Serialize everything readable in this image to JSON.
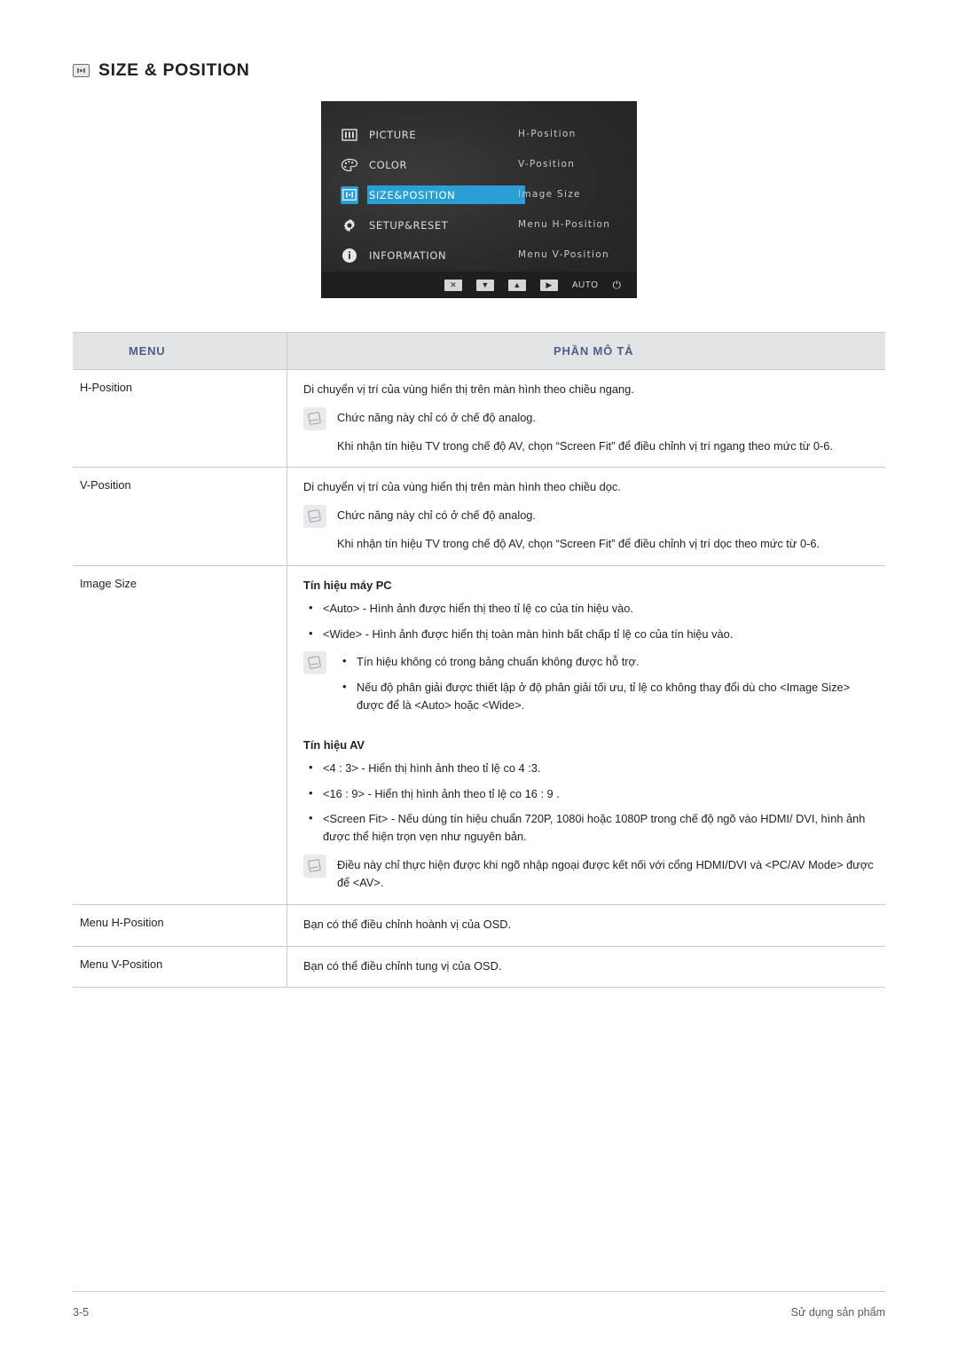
{
  "page": {
    "title": "SIZE & POSITION",
    "title_icon": "size-position-icon",
    "footer_left": "3-5",
    "footer_right": "Sử dụng sản phẩm"
  },
  "osd": {
    "menu_items": [
      {
        "icon": "picture-icon",
        "label": "PICTURE",
        "selected": false
      },
      {
        "icon": "color-icon",
        "label": "COLOR",
        "selected": false
      },
      {
        "icon": "size-position-icon",
        "label": "SIZE&POSITION",
        "selected": true
      },
      {
        "icon": "setup-reset-icon",
        "label": "SETUP&RESET",
        "selected": false
      },
      {
        "icon": "information-icon",
        "label": "INFORMATION",
        "selected": false
      }
    ],
    "submenu_items": [
      "H-Position",
      "V-Position",
      "Image Size",
      "Menu H-Position",
      "Menu V-Position"
    ],
    "buttons": [
      {
        "name": "exit-button",
        "glyph": "✕"
      },
      {
        "name": "down-button",
        "glyph": "▼"
      },
      {
        "name": "up-button",
        "glyph": "▲"
      },
      {
        "name": "enter-button",
        "glyph": "▶"
      },
      {
        "name": "auto-button",
        "glyph": "AUTO"
      },
      {
        "name": "power-button",
        "glyph": "⏻"
      }
    ]
  },
  "table": {
    "headers": {
      "menu": "MENU",
      "description": "PHẦN MÔ TẢ"
    },
    "rows": [
      {
        "menu": "H-Position",
        "desc_main": "Di chuyển vị trí của vùng hiển thị trên màn hình theo chiều ngang.",
        "note1": "Chức năng này chỉ có ở chế độ analog.",
        "note2": "Khi nhận tín hiệu TV trong chế độ AV, chọn “Screen Fit” để điều chỉnh vị trí ngang theo mức từ 0-6."
      },
      {
        "menu": "V-Position",
        "desc_main": "Di chuyển vị trí của vùng hiển thị trên màn hình theo chiều dọc.",
        "note1": "Chức năng này chỉ có ở chế độ analog.",
        "note2": "Khi nhận tín hiệu TV trong chế độ AV, chọn “Screen Fit” để điều chỉnh vị trí dọc theo mức từ 0-6."
      },
      {
        "menu": "Image Size",
        "pc_heading": "Tín hiệu máy PC",
        "pc_bullets": [
          "<Auto> - Hình ảnh được hiển thị theo tỉ lệ co của tín hiệu vào.",
          "<Wide> - Hình ảnh được hiển thị toàn màn hình bất chấp tỉ lệ co của tín hiệu vào."
        ],
        "pc_note_bullets": [
          "Tín hiệu không có trong bảng chuẩn không được hỗ trợ.",
          "Nếu độ phân giải được thiết lập ở độ phân giải tối ưu, tỉ lệ co không thay đổi dù cho <Image Size> được để là <Auto> hoặc <Wide>."
        ],
        "av_heading": "Tín hiệu AV",
        "av_bullets": [
          "<4 : 3> - Hiển thị hình ảnh theo tỉ lệ co 4 :3.",
          "<16 : 9> - Hiển thị hình ảnh theo tỉ lệ co 16 : 9 .",
          "<Screen Fit> - Nếu dùng tín hiệu chuẩn 720P, 1080i hoặc 1080P trong chế độ ngõ vào HDMI/ DVI, hình ảnh được thể hiện trọn vẹn như nguyên bản."
        ],
        "av_note": "Điều này chỉ thực hiện được khi ngõ nhập ngoại được kết nối với cổng HDMI/DVI và <PC/AV Mode> được để <AV>."
      },
      {
        "menu": "Menu H-Position",
        "desc_main": "Bạn có thể điều chỉnh hoành vị của OSD."
      },
      {
        "menu": "Menu V-Position",
        "desc_main": "Bạn có thể điều chỉnh tung vị của OSD."
      }
    ]
  },
  "colors": {
    "header_text": "#4e5e86",
    "header_bg": "#e3e4e6",
    "osd_accent": "#2a9fd6",
    "rule": "#c9cacc"
  }
}
